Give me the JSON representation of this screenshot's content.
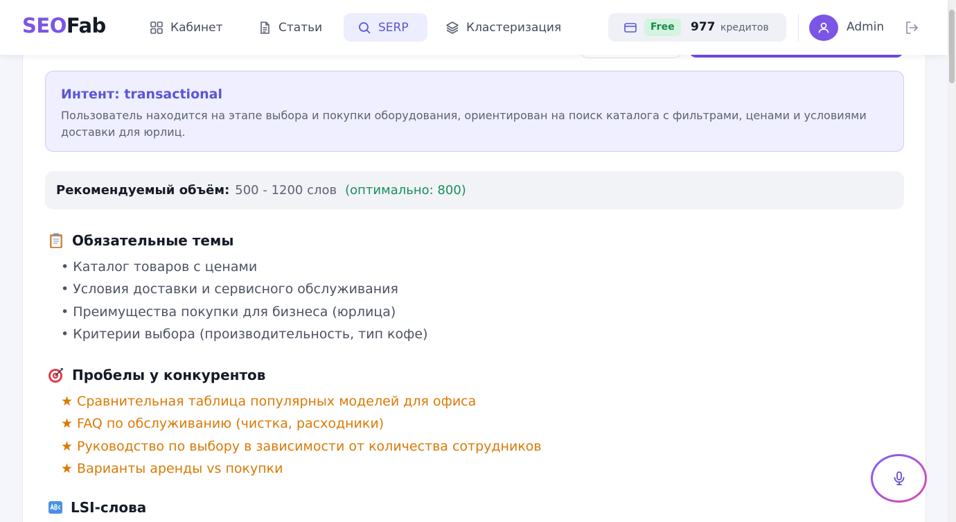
{
  "header": {
    "logo_part1": "SEO",
    "logo_part2": "Fab",
    "nav": [
      {
        "label": "Кабинет",
        "icon": "grid-icon"
      },
      {
        "label": "Статьи",
        "icon": "document-icon"
      },
      {
        "label": "SERP",
        "icon": "search-icon",
        "active": true
      },
      {
        "label": "Кластеризация",
        "icon": "layers-icon"
      }
    ],
    "plan": "Free",
    "credits_count": "977",
    "credits_label": "кредитов",
    "user_name": "Admin"
  },
  "intent": {
    "title": "Интент: transactional",
    "description": "Пользователь находится на этапе выбора и покупки оборудования, ориентирован на поиск каталога с фильтрами, ценами и условиями доставки для юрлиц."
  },
  "volume": {
    "label": "Рекомендуемый объём:",
    "range": "500 - 1200 слов",
    "optimal": "(оптимально: 800)"
  },
  "topics": {
    "title": "Обязательные темы",
    "items": [
      "Каталог товаров с ценами",
      "Условия доставки и сервисного обслуживания",
      "Преимущества покупки для бизнеса (юрлица)",
      "Критерии выбора (производительность, тип кофе)"
    ]
  },
  "gaps": {
    "title": "Пробелы у конкурентов",
    "items": [
      "Сравнительная таблица популярных моделей для офиса",
      "FAQ по обслуживанию (чистка, расходники)",
      "Руководство по выбору в зависимости от количества сотрудников",
      "Варианты аренды vs покупки"
    ]
  },
  "lsi": {
    "title": "LSI-слова"
  },
  "colors": {
    "accent": "#7b55e6",
    "active_nav": "#5b55d6",
    "optimal_green": "#16905a",
    "gap_orange": "#d97a06"
  }
}
